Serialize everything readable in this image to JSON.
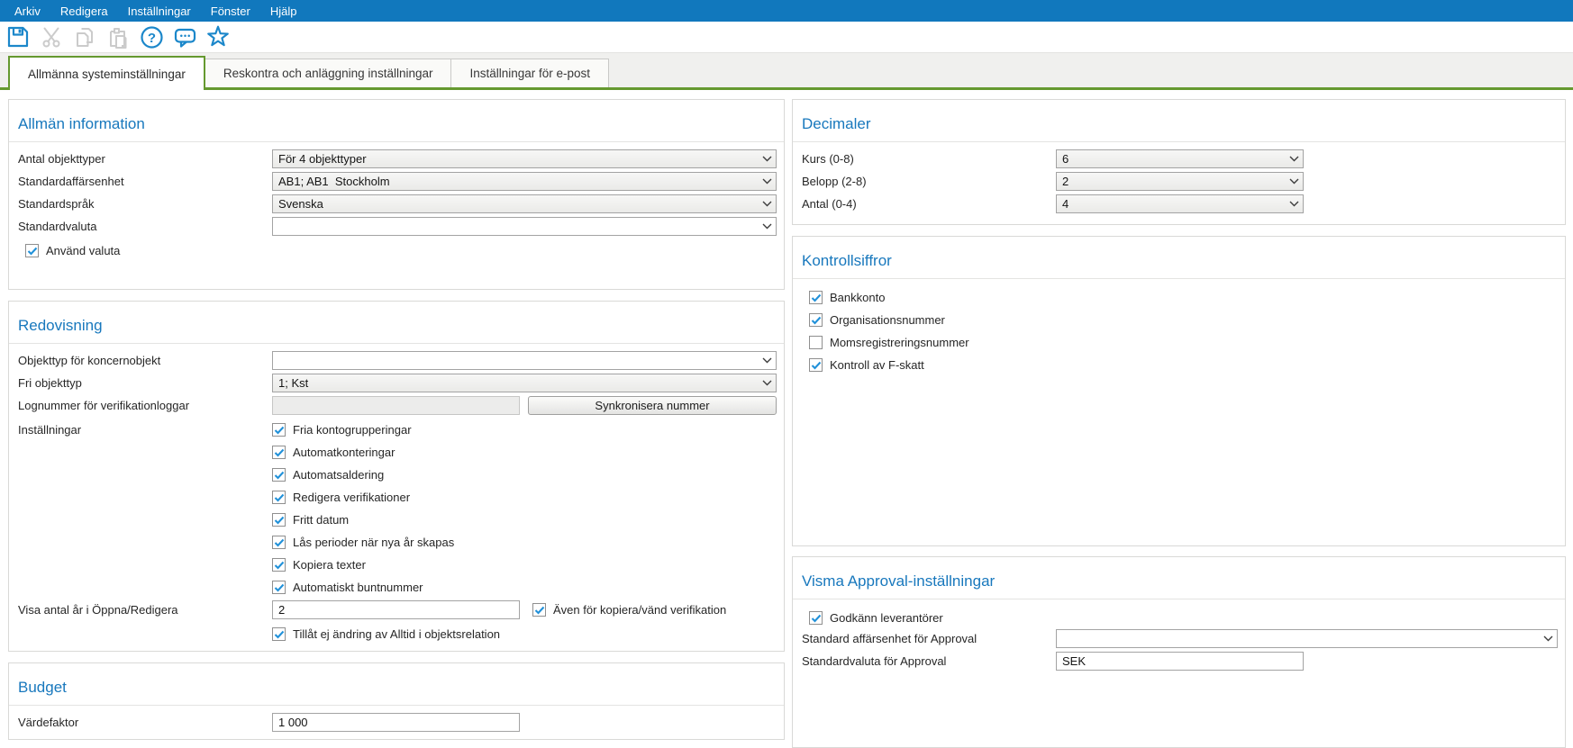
{
  "menu": {
    "items": [
      "Arkiv",
      "Redigera",
      "Inställningar",
      "Fönster",
      "Hjälp"
    ]
  },
  "toolbar": {
    "icons": [
      "save-icon",
      "cut-icon",
      "copy-icon",
      "paste-icon",
      "help-icon",
      "comments-icon",
      "favorite-star-icon"
    ]
  },
  "tabs": {
    "items": [
      {
        "label": "Allmänna systeminställningar",
        "active": true
      },
      {
        "label": "Reskontra och anläggning inställningar",
        "active": false
      },
      {
        "label": "Inställningar för e-post",
        "active": false
      }
    ]
  },
  "colors": {
    "menu_bar_blue": "#1178bd",
    "icon_blue": "#1b87ca",
    "icon_disabled_gray": "#cbcbcb",
    "section_header_blue": "#1878bd",
    "active_tab_green": "#65992f",
    "checkmark_blue": "#2191d9"
  },
  "panels": {
    "allman_information": {
      "title": "Allmän information",
      "antal_objekttyper": {
        "label": "Antal objekttyper",
        "value": "För 4 objekttyper"
      },
      "standardaffarsenhet": {
        "label": "Standardaffärsenhet",
        "value": "AB1; AB1  Stockholm"
      },
      "standardsprak": {
        "label": "Standardspråk",
        "value": "Svenska"
      },
      "standardvaluta": {
        "label": "Standardvaluta",
        "value": ""
      },
      "anvand_valuta": {
        "label": "Använd valuta",
        "checked": true
      }
    },
    "redovisning": {
      "title": "Redovisning",
      "objekttyp_koncernobjekt": {
        "label": "Objekttyp för koncernobjekt",
        "value": ""
      },
      "fri_objekttyp": {
        "label": "Fri objekttyp",
        "value": "1; Kst"
      },
      "lognummer": {
        "label": "Lognummer för verifikationloggar",
        "value": "",
        "button_label": "Synkronisera nummer"
      },
      "installningar_label": "Inställningar",
      "checkboxes": [
        {
          "label": "Fria kontogrupperingar",
          "checked": true
        },
        {
          "label": "Automatkonteringar",
          "checked": true
        },
        {
          "label": "Automatsaldering",
          "checked": true
        },
        {
          "label": "Redigera verifikationer",
          "checked": true
        },
        {
          "label": "Fritt datum",
          "checked": true
        },
        {
          "label": "Lås perioder när nya år skapas",
          "checked": true
        },
        {
          "label": "Kopiera texter",
          "checked": true
        },
        {
          "label": "Automatiskt buntnummer",
          "checked": true
        }
      ],
      "visa_antal_ar": {
        "label": "Visa antal år i Öppna/Redigera",
        "value": "2"
      },
      "aven_for_kopiera": {
        "label": "Även för kopiera/vänd verifikation",
        "checked": true
      },
      "tillat_ej_andring": {
        "label": "Tillåt ej ändring av Alltid i objektsrelation",
        "checked": true
      }
    },
    "budget": {
      "title": "Budget",
      "vardefaktor": {
        "label": "Värdefaktor",
        "value": "1 000"
      }
    },
    "decimaler": {
      "title": "Decimaler",
      "rows": [
        {
          "label": "Kurs (0-8)",
          "value": "6"
        },
        {
          "label": "Belopp (2-8)",
          "value": "2"
        },
        {
          "label": "Antal (0-4)",
          "value": "4"
        }
      ]
    },
    "kontrollsiffror": {
      "title": "Kontrollsiffror",
      "checkboxes": [
        {
          "label": "Bankkonto",
          "checked": true
        },
        {
          "label": "Organisationsnummer",
          "checked": true
        },
        {
          "label": "Momsregistreringsnummer",
          "checked": false
        },
        {
          "label": "Kontroll av F-skatt",
          "checked": true
        }
      ]
    },
    "visma_approval": {
      "title": "Visma Approval-inställningar",
      "godkann_leverantorer": {
        "label": "Godkänn leverantörer",
        "checked": true
      },
      "standard_affarsenhet": {
        "label": "Standard affärsenhet för Approval",
        "value": ""
      },
      "standardvaluta": {
        "label": "Standardvaluta för Approval",
        "value": "SEK"
      }
    }
  }
}
